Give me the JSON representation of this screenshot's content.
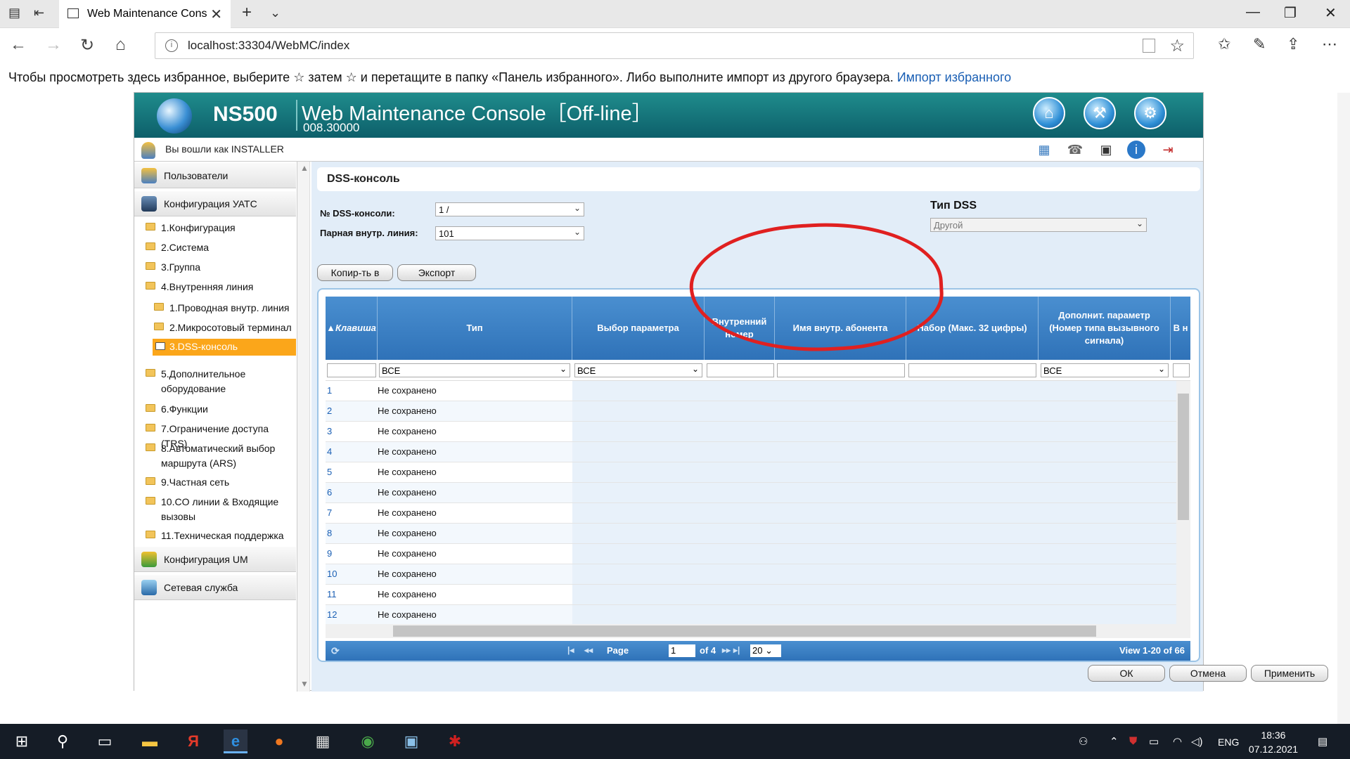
{
  "browser": {
    "tab_title": "Web Maintenance Cons",
    "url": "localhost:33304/WebMC/index",
    "favorites_text": "Чтобы просмотреть здесь избранное, выберите",
    "favorites_text2": "затем ☆ и перетащите в папку «Панель избранного». Либо выполните импорт из другого браузера.",
    "favorites_link": "Импорт избранного"
  },
  "app": {
    "model": "NS500",
    "console_title": "Web Maintenance Console［Off-line］",
    "version": "008.30000",
    "logged_in": "Вы вошли как INSTALLER"
  },
  "sidebar": {
    "groups": [
      "Пользователи",
      "Конфигурация УАТС",
      "Конфигурация UM",
      "Сетевая служба"
    ],
    "items": [
      "1.Конфигурация",
      "2.Система",
      "3.Группа",
      "4.Внутренняя линия",
      "1.Проводная внутр. линия",
      "2.Микросотовый терминал",
      "3.DSS-консоль",
      "5.Дополнительное оборудование",
      "6.Функции",
      "7.Ограничение доступа (TRS)",
      "8.Автоматический выбор маршрута (ARS)",
      "9.Частная сеть",
      "10.CO линии & Входящие вызовы",
      "11.Техническая поддержка"
    ]
  },
  "main": {
    "title": "DSS-консоль",
    "dss_no_label": "№ DSS-консоли:",
    "dss_no_value": "1 /",
    "paired_label": "Парная внутр. линия:",
    "paired_value": "101",
    "dss_type_label": "Тип DSS",
    "dss_type_value": "Другой",
    "copy_btn": "Копир-ть в",
    "export_btn": "Экспорт",
    "columns": [
      "Клавиша",
      "Тип",
      "Выбор параметра",
      "Внутренний номер",
      "Имя внутр. абонента",
      "Набор (Макс. 32 цифры)",
      "Дополнит. параметр (Номер типа вызывного сигнала)",
      "В н"
    ],
    "filters": {
      "type": "ВСЕ",
      "param": "ВСЕ",
      "extra": "ВСЕ"
    },
    "rows": [
      {
        "key": "1",
        "type": "Не сохранено"
      },
      {
        "key": "2",
        "type": "Не сохранено"
      },
      {
        "key": "3",
        "type": "Не сохранено"
      },
      {
        "key": "4",
        "type": "Не сохранено"
      },
      {
        "key": "5",
        "type": "Не сохранено"
      },
      {
        "key": "6",
        "type": "Не сохранено"
      },
      {
        "key": "7",
        "type": "Не сохранено"
      },
      {
        "key": "8",
        "type": "Не сохранено"
      },
      {
        "key": "9",
        "type": "Не сохранено"
      },
      {
        "key": "10",
        "type": "Не сохранено"
      },
      {
        "key": "11",
        "type": "Не сохранено"
      },
      {
        "key": "12",
        "type": "Не сохранено"
      }
    ],
    "pager": {
      "page_label": "Page",
      "page": "1",
      "of": "of 4",
      "size": "20",
      "view": "View 1-20 of 66"
    },
    "ok_btn": "ОК",
    "cancel_btn": "Отмена",
    "apply_btn": "Применить"
  },
  "taskbar": {
    "lang": "ENG",
    "time": "18:36",
    "date": "07.12.2021"
  },
  "colors": {
    "banner": "#1f8c8c",
    "accent": "#fba61a",
    "header_blue": "#3a80c4",
    "circle": "#e02020"
  }
}
